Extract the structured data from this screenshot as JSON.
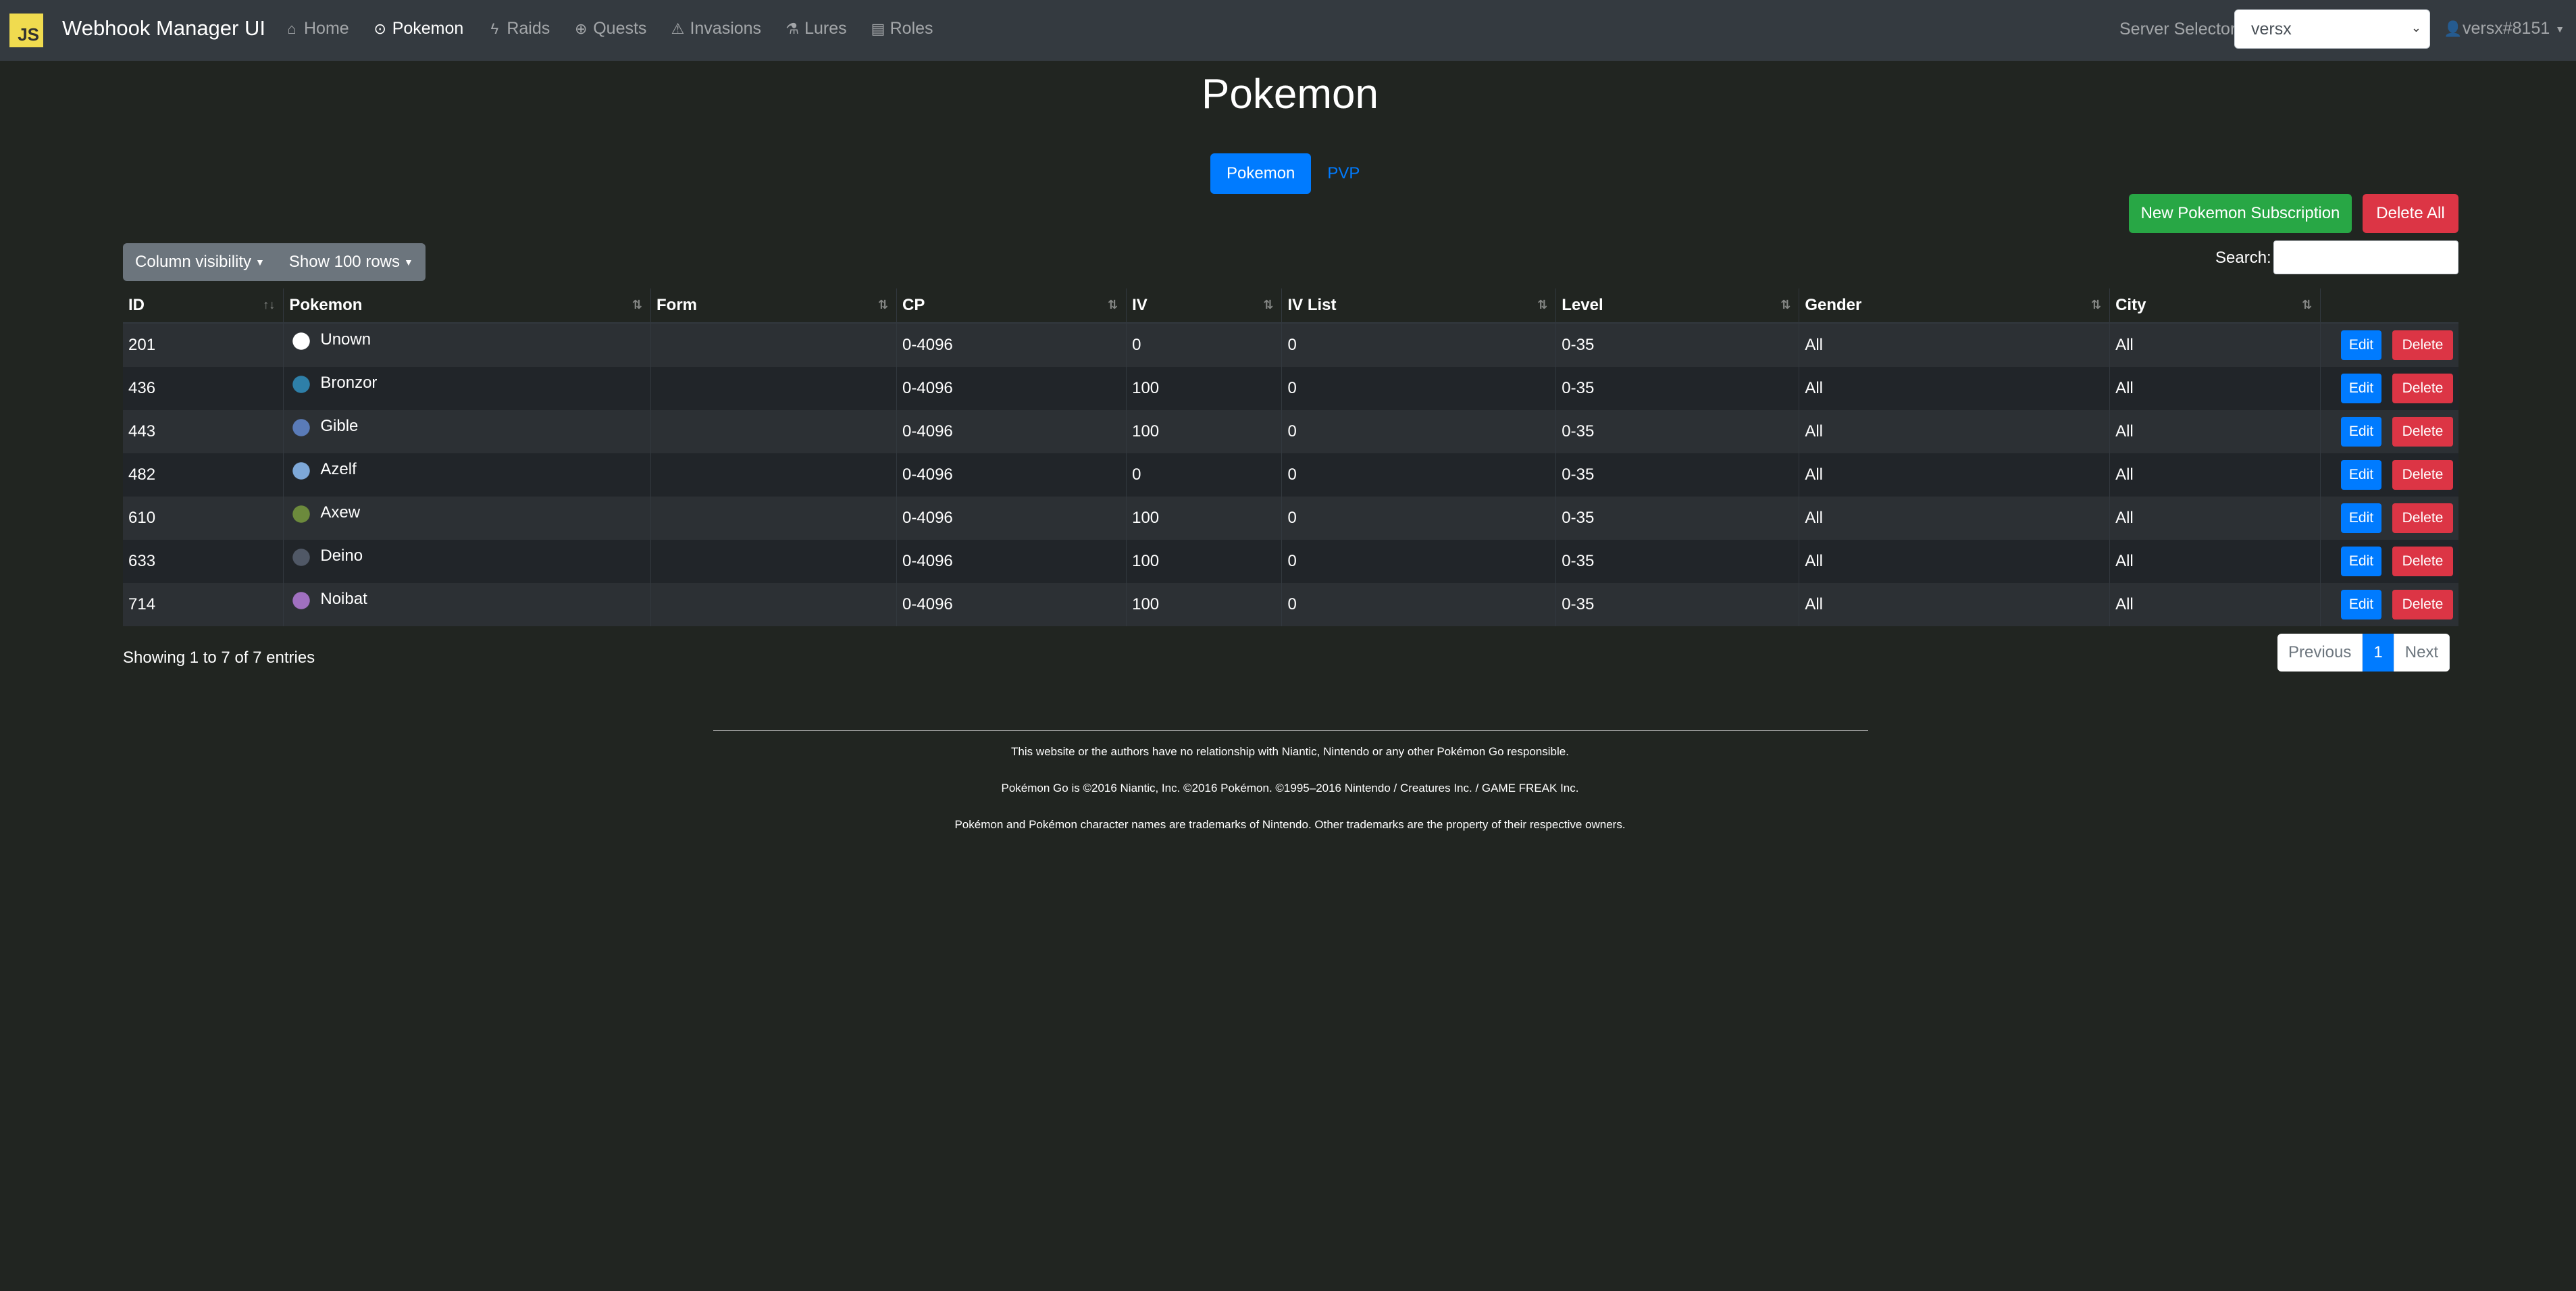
{
  "navbar": {
    "logo": "JS",
    "brand": "Webhook Manager UI",
    "links": [
      {
        "icon": "home-icon",
        "label": "Home",
        "active": false
      },
      {
        "icon": "pokeball-icon",
        "label": "Pokemon",
        "active": true
      },
      {
        "icon": "bolt-icon",
        "label": "Raids",
        "active": false
      },
      {
        "icon": "search-icon",
        "label": "Quests",
        "active": false
      },
      {
        "icon": "warning-icon",
        "label": "Invasions",
        "active": false
      },
      {
        "icon": "flask-icon",
        "label": "Lures",
        "active": false
      },
      {
        "icon": "id-card-icon",
        "label": "Roles",
        "active": false
      }
    ],
    "server_label": "Server Selector",
    "server_value": "versx",
    "user": "versx#8151"
  },
  "page": {
    "title": "Pokemon",
    "tabs": [
      "Pokemon",
      "PVP"
    ],
    "new_button": "New Pokemon Subscription",
    "delete_all_button": "Delete All",
    "column_visibility": "Column visibility",
    "show_rows": "Show 100 rows",
    "search_label": "Search:",
    "search_value": ""
  },
  "table": {
    "columns": [
      "ID",
      "Pokemon",
      "Form",
      "CP",
      "IV",
      "IV List",
      "Level",
      "Gender",
      "City"
    ],
    "rows": [
      {
        "id": "201",
        "pokemon": "Unown",
        "form": "",
        "cp": "0-4096",
        "iv": "0",
        "iv_list": "0",
        "level": "0-35",
        "gender": "All",
        "city": "All",
        "color": "#ffffff"
      },
      {
        "id": "436",
        "pokemon": "Bronzor",
        "form": "",
        "cp": "0-4096",
        "iv": "100",
        "iv_list": "0",
        "level": "0-35",
        "gender": "All",
        "city": "All",
        "color": "#2e7fa8"
      },
      {
        "id": "443",
        "pokemon": "Gible",
        "form": "",
        "cp": "0-4096",
        "iv": "100",
        "iv_list": "0",
        "level": "0-35",
        "gender": "All",
        "city": "All",
        "color": "#5a7bb8"
      },
      {
        "id": "482",
        "pokemon": "Azelf",
        "form": "",
        "cp": "0-4096",
        "iv": "0",
        "iv_list": "0",
        "level": "0-35",
        "gender": "All",
        "city": "All",
        "color": "#7ea8d8"
      },
      {
        "id": "610",
        "pokemon": "Axew",
        "form": "",
        "cp": "0-4096",
        "iv": "100",
        "iv_list": "0",
        "level": "0-35",
        "gender": "All",
        "city": "All",
        "color": "#6c8a3c"
      },
      {
        "id": "633",
        "pokemon": "Deino",
        "form": "",
        "cp": "0-4096",
        "iv": "100",
        "iv_list": "0",
        "level": "0-35",
        "gender": "All",
        "city": "All",
        "color": "#505866"
      },
      {
        "id": "714",
        "pokemon": "Noibat",
        "form": "",
        "cp": "0-4096",
        "iv": "100",
        "iv_list": "0",
        "level": "0-35",
        "gender": "All",
        "city": "All",
        "color": "#a070c0"
      }
    ],
    "edit_label": "Edit",
    "delete_label": "Delete"
  },
  "pagination": {
    "info": "Showing 1 to 7 of 7 entries",
    "previous": "Previous",
    "current": "1",
    "next": "Next"
  },
  "footer": {
    "line1": "This website or the authors have no relationship with Niantic, Nintendo or any other Pokémon Go responsible.",
    "line2": "Pokémon Go is ©2016 Niantic, Inc. ©2016 Pokémon. ©1995–2016 Nintendo / Creatures Inc. / GAME FREAK Inc.",
    "line3": "Pokémon and Pokémon character names are trademarks of Nintendo. Other trademarks are the property of their respective owners."
  },
  "colors": {
    "background": "#212521",
    "navbar": "#343a40",
    "primary": "#007bff",
    "success": "#28a745",
    "danger": "#dc3545",
    "secondary": "#6c757d"
  }
}
